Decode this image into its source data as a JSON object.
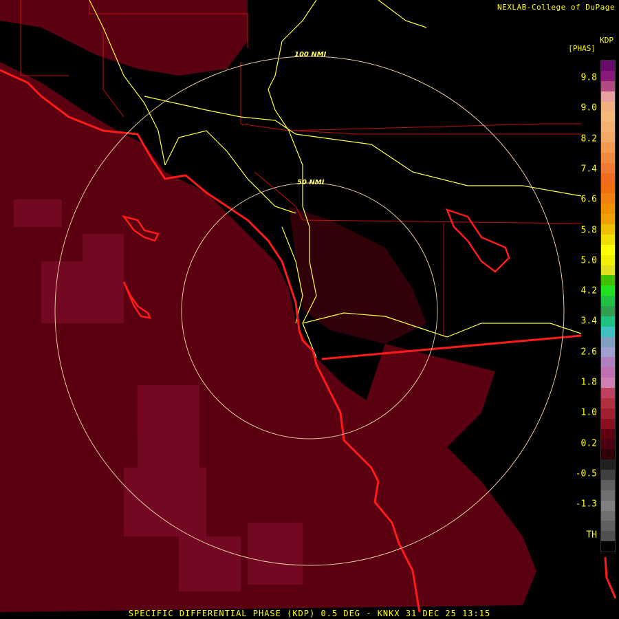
{
  "map": {
    "credit": "NEXLAB-College of DuPage",
    "footer": "SPECIFIC DIFFERENTIAL PHASE (KDP) 0.5 DEG - KNKX 31 DEC 25 13:15",
    "product": "KDP",
    "station": "KNKX",
    "elevation": "0.5 DEG",
    "valid_time": "31 DEC 25 13:15",
    "range_rings": [
      {
        "label": "100 NMI"
      },
      {
        "label": "50 NMI"
      }
    ],
    "colors": {
      "background": "#000000",
      "echo": "#5a0011",
      "echo_light": "#7a0a28",
      "coast": "#ff1a1a",
      "roads": "#ffff40",
      "county": "#c01010",
      "rings": "#e8c8a0",
      "text": "#ffff00"
    }
  },
  "legend": {
    "unit": "[PHAS]",
    "labels": [
      "9.8",
      "9.0",
      "8.2",
      "7.4",
      "6.6",
      "5.8",
      "5.0",
      "4.2",
      "3.4",
      "2.6",
      "1.8",
      "1.0",
      "0.2",
      "-0.5",
      "-1.3",
      "TH"
    ],
    "colors": [
      "#6a0a6a",
      "#8a1a7a",
      "#b04a80",
      "#e8a0a0",
      "#f0b080",
      "#f4b878",
      "#f4b070",
      "#f4a868",
      "#f49a50",
      "#f08a40",
      "#f07a30",
      "#f06a20",
      "#f07010",
      "#f08010",
      "#f09000",
      "#f0a000",
      "#f0c000",
      "#f0e000",
      "#ffff00",
      "#f0f000",
      "#e0e020",
      "#40c000",
      "#20e020",
      "#20c040",
      "#30a050",
      "#20c080",
      "#40c0c0",
      "#80a0c0",
      "#a0a0d0",
      "#b080c0",
      "#c070b0",
      "#d080b0",
      "#c04060",
      "#b03040",
      "#a02030",
      "#8a1020",
      "#600010",
      "#4a0010",
      "#300008",
      "#202020",
      "#404040",
      "#606060",
      "#707070",
      "#808080",
      "#707070",
      "#606060",
      "#505050",
      "#000000"
    ]
  }
}
